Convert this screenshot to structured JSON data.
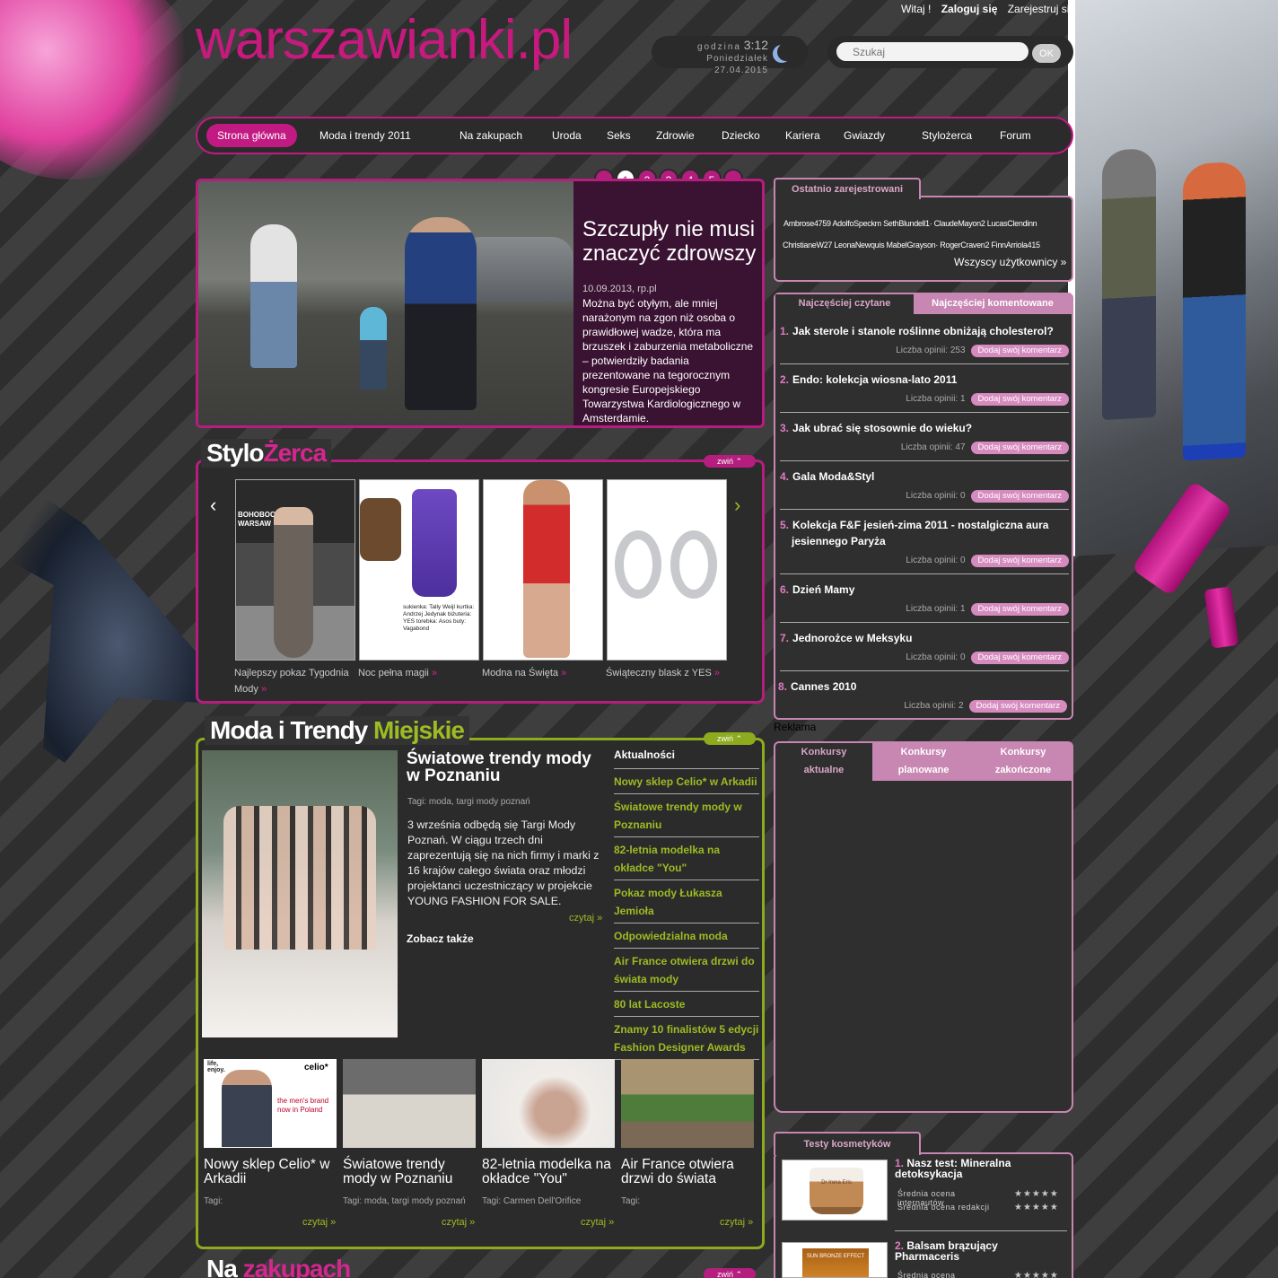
{
  "header": {
    "logo": "warszawianki.pl",
    "greeting": "Witaj !",
    "login": "Zaloguj się",
    "register": "Zarejestruj się",
    "clock_label": "godzina",
    "clock_time": "3:12",
    "clock_date": "Poniedziałek 27.04.2015",
    "search_placeholder": "Szukaj",
    "search_button": "OK"
  },
  "nav": [
    "Strona główna",
    "Moda i trendy 2011",
    "Na zakupach",
    "Uroda",
    "Seks",
    "Zdrowie",
    "Dziecko",
    "Kariera",
    "Gwiazdy",
    "Stylożerca",
    "Forum"
  ],
  "slider": {
    "pages": [
      "1",
      "2",
      "3",
      "4",
      "5"
    ],
    "active_page": "1",
    "title": "Szczupły nie musi znaczyć zdrowszy",
    "meta": "10.09.2013, rp.pl",
    "description": "Można być otyłym, ale mniej narażonym na zgon niż osoba o prawidłowej wadze, która ma brzuszek i zaburzenia metaboliczne – potwierdziły badania prezentowane na tegorocznym kongresie Europejskiego Towarzystwa Kardiologicznego w Amsterdamie.",
    "more": "»"
  },
  "stylozerca": {
    "title_a": "Stylo",
    "title_b": "Żerca",
    "collapse": "zwiń",
    "items": [
      {
        "caption": "Najlepszy pokaz Tygodnia Mody",
        "label": "BOHOBOCO WARSAW"
      },
      {
        "caption": "Noc pełna magii",
        "label": "sukienka: Tally Weijl kurtka: Andrzej Jedynak biżuteria: YES torebka: Asos buty: Vagabond"
      },
      {
        "caption": "Modna na Święta",
        "label": ""
      },
      {
        "caption": "Świąteczny blask z YES",
        "label": ""
      }
    ]
  },
  "moda": {
    "title_a": "Moda i Trendy",
    "title_b": "Miejskie",
    "collapse": "zwiń",
    "main_title": "Światowe trendy mody w Poznaniu",
    "main_tags": "Tagi: moda, targi mody poznań",
    "main_text": "3 września odbędą się Targi Mody Poznań. W ciągu trzech dni zaprezentują się na nich firmy i marki z 16 krajów całego świata oraz młodzi projektanci uczestniczący w projekcie YOUNG FASHION FOR SALE.",
    "main_more": "czytaj »",
    "see_also": "Zobacz także",
    "news_header": "Aktualności",
    "news": [
      "Nowy sklep Celio* w Arkadii",
      "Światowe trendy mody w Poznaniu",
      "82-letnia modelka na okładce \"You\"",
      "Pokaz mody Łukasza Jemioła",
      "Odpowiedzialna moda",
      "Air France otwiera drzwi do świata mody",
      "80 lat Lacoste",
      "Znamy 10 finalistów 5 edycji Fashion Designer Awards"
    ],
    "cards": [
      {
        "title": "Nowy sklep Celio* w Arkadii",
        "tags": "Tagi:",
        "more": "czytaj »"
      },
      {
        "title": "Światowe trendy mody w Poznaniu",
        "tags": "Tagi: moda, targi mody poznań",
        "more": "czytaj »"
      },
      {
        "title": "82-letnia modelka na okładce \"You\"",
        "tags": "Tagi: Carmen Dell'Orifice",
        "more": "czytaj »"
      },
      {
        "title": "Air France otwiera drzwi do świata",
        "tags": "Tagi:",
        "more": "czytaj »"
      }
    ],
    "celio_ad": {
      "brand": "celio*",
      "slogan": "the men's brand now in Poland",
      "tag": "life, enjoy."
    }
  },
  "na_zakupach": {
    "title_a": "Na",
    "title_b": "zakupach",
    "collapse": "zwiń"
  },
  "recent_users": {
    "tab": "Ostatnio zarejestrowani",
    "row1": "Ambrose4759   AdolfoSpeckm   SethBlundell1·  ClaudeMayon2  LucasClendinn",
    "row2": "ChristianeW27   LeonaNewquis  MabelGrayson·  RogerCraven2  FinnArriola415",
    "all": "Wszyscy użytkownicy »"
  },
  "popular": {
    "tab_read": "Najczęściej czytane",
    "tab_commented": "Najczęściej komentowane",
    "button": "Dodaj swój komentarz",
    "items": [
      {
        "n": "1.",
        "title": "Jak sterole i stanole roślinne obniżają cholesterol?",
        "meta": "Liczba opinii: 253"
      },
      {
        "n": "2.",
        "title": "Endo: kolekcja wiosna-lato 2011",
        "meta": "Liczba opinii: 1"
      },
      {
        "n": "3.",
        "title": "Jak ubrać się stosownie do wieku?",
        "meta": "Liczba opinii: 47"
      },
      {
        "n": "4.",
        "title": "Gala Moda&Styl",
        "meta": "Liczba opinii: 0"
      },
      {
        "n": "5.",
        "title": "Kolekcja F&F jesień-zima 2011 - nostalgiczna aura jesiennego Paryża",
        "meta": "Liczba opinii: 0"
      },
      {
        "n": "6.",
        "title": "Dzień Mamy",
        "meta": "Liczba opinii: 1"
      },
      {
        "n": "7.",
        "title": "Jednorożce w Meksyku",
        "meta": "Liczba opinii: 0"
      },
      {
        "n": "8.",
        "title": "Cannes 2010",
        "meta": "Liczba opinii: 2"
      }
    ]
  },
  "reklama": "Reklama",
  "contests": {
    "tabs": [
      "Konkursy aktualne",
      "Konkursy planowane",
      "Konkursy zakończone"
    ]
  },
  "cosmetics": {
    "tab": "Testy kosmetyków",
    "items": [
      {
        "n": "1.",
        "title": "Nasz test: Mineralna detoksykacja",
        "r1": "Średnia ocena internautów",
        "r2": "Średnia ocena redakcji",
        "brand": "Dr Irena Eris"
      },
      {
        "n": "2.",
        "title": "Balsam brązujący Pharmaceris",
        "r1": "Średnia ocena",
        "r2": "",
        "brand": "SUN BRONZE EFFECT"
      }
    ],
    "stars": "★★★★★"
  }
}
